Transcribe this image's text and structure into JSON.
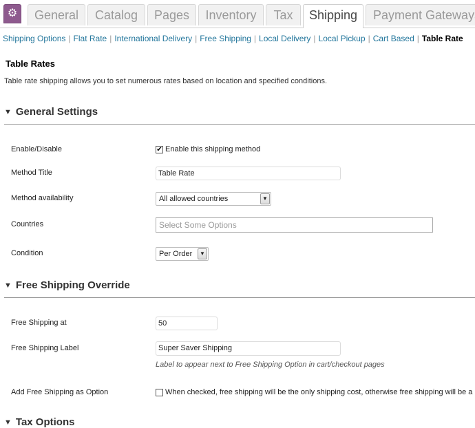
{
  "tabs": {
    "gear_icon": "gear-icon",
    "items": [
      {
        "label": "General"
      },
      {
        "label": "Catalog"
      },
      {
        "label": "Pages"
      },
      {
        "label": "Inventory"
      },
      {
        "label": "Tax"
      },
      {
        "label": "Shipping"
      },
      {
        "label": "Payment Gateways"
      }
    ],
    "active": "Shipping"
  },
  "subnav": {
    "links": [
      {
        "label": "Shipping Options"
      },
      {
        "label": "Flat Rate"
      },
      {
        "label": "International Delivery"
      },
      {
        "label": "Free Shipping"
      },
      {
        "label": "Local Delivery"
      },
      {
        "label": "Local Pickup"
      },
      {
        "label": "Cart Based"
      }
    ],
    "current": "Table Rate",
    "separator": "|"
  },
  "page": {
    "title": "Table Rates",
    "description": "Table rate shipping allows you to set numerous rates based on location and specified conditions."
  },
  "sections": {
    "general": {
      "title": "General Settings",
      "enable_label": "Enable/Disable",
      "enable_checkbox_label": "Enable this shipping method",
      "enable_checked": true,
      "method_title_label": "Method Title",
      "method_title_value": "Table Rate",
      "availability_label": "Method availability",
      "availability_value": "All allowed countries",
      "countries_label": "Countries",
      "countries_placeholder": "Select Some Options",
      "condition_label": "Condition",
      "condition_value": "Per Order"
    },
    "free_shipping": {
      "title": "Free Shipping Override",
      "at_label": "Free Shipping at",
      "at_value": "50",
      "label_label": "Free Shipping Label",
      "label_value": "Super Saver Shipping",
      "label_hint": "Label to appear next to Free Shipping Option in cart/checkout pages",
      "option_label": "Add Free Shipping as Option",
      "option_checkbox_text": "When checked, free shipping will be the only shipping cost, otherwise free shipping will be a",
      "option_checked": false
    },
    "tax": {
      "title": "Tax Options"
    }
  },
  "colors": {
    "accent_purple": "#8e5a8e",
    "link_blue": "#21759b"
  }
}
